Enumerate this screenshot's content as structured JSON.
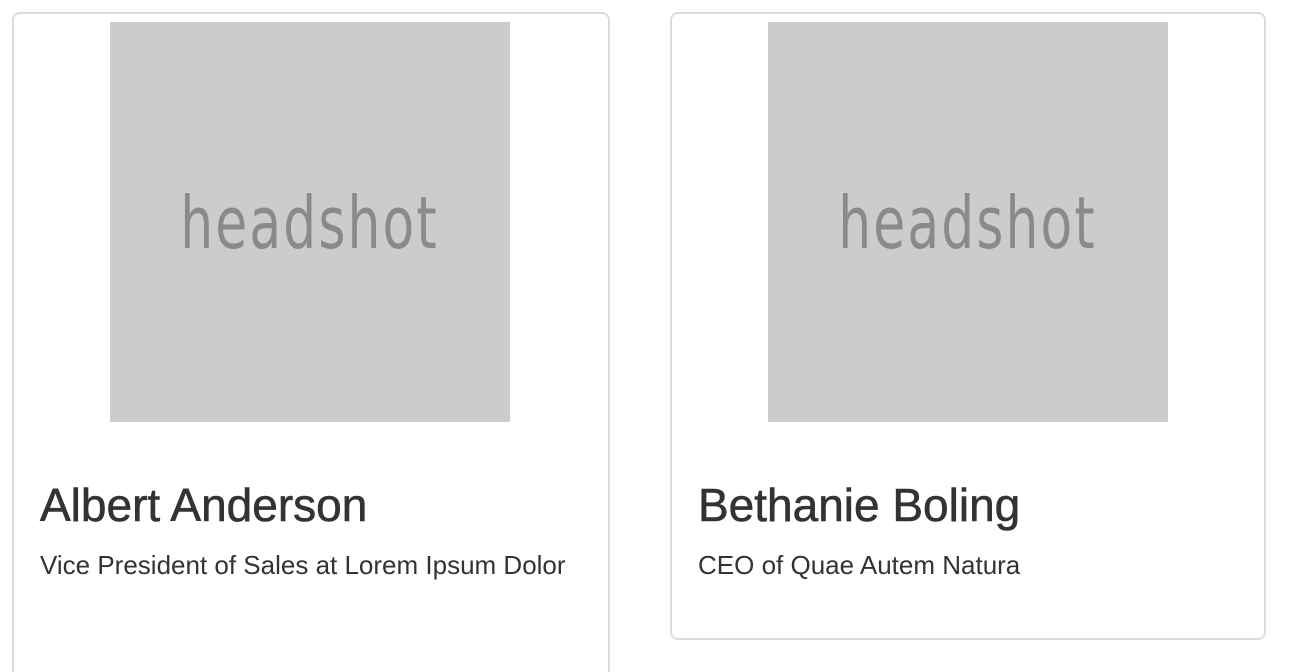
{
  "cards": [
    {
      "image_label": "headshot",
      "name": "Albert Anderson",
      "title": "Vice President of Sales at Lorem Ipsum Dolor"
    },
    {
      "image_label": "headshot",
      "name": "Bethanie Boling",
      "title": "CEO of Quae Autem Natura"
    }
  ],
  "colors": {
    "placeholder_bg": "#cccccc",
    "placeholder_text": "#8a8a8a",
    "card_border": "#dddddd",
    "text": "#333333"
  }
}
